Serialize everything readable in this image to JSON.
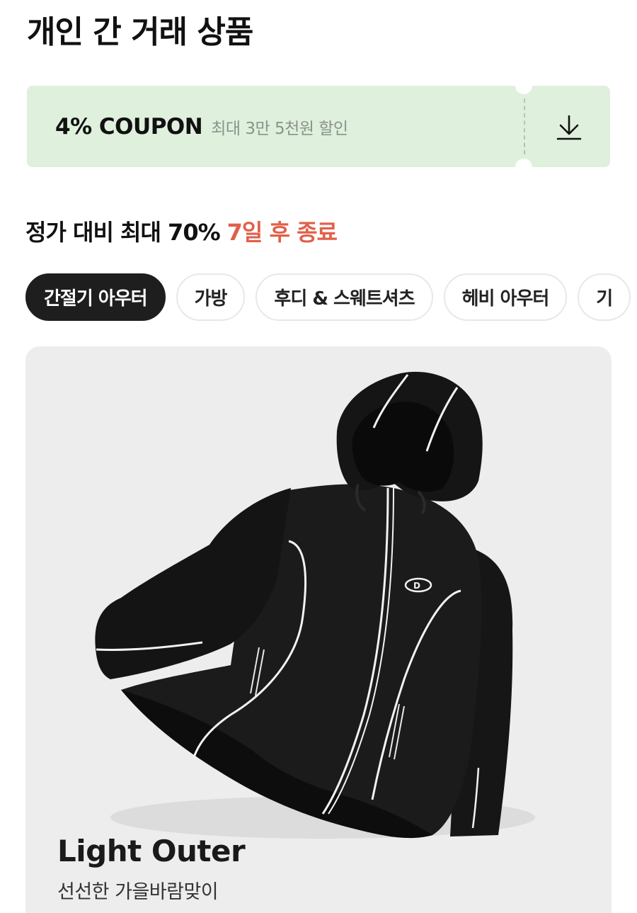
{
  "page": {
    "title": "개인 간 거래 상품"
  },
  "coupon": {
    "label": "4% COUPON",
    "description": "최대 3만 5천원 할인",
    "icon": "download-icon",
    "background_color": "#dff0dd"
  },
  "sale": {
    "heading": "정가 대비 최대 70%",
    "countdown": "7일 후 종료",
    "countdown_color": "#e0604a"
  },
  "categories": {
    "items": [
      {
        "label": "간절기 아우터",
        "selected": true
      },
      {
        "label": "가방",
        "selected": false
      },
      {
        "label": "후디 & 스웨트셔츠",
        "selected": false
      },
      {
        "label": "헤비 아우터",
        "selected": false
      },
      {
        "label": "기",
        "selected": false
      }
    ]
  },
  "product_card": {
    "title": "Light Outer",
    "subtitle": "선선한 가을바람맞이",
    "image": "black-hooded-windbreaker-jacket"
  }
}
